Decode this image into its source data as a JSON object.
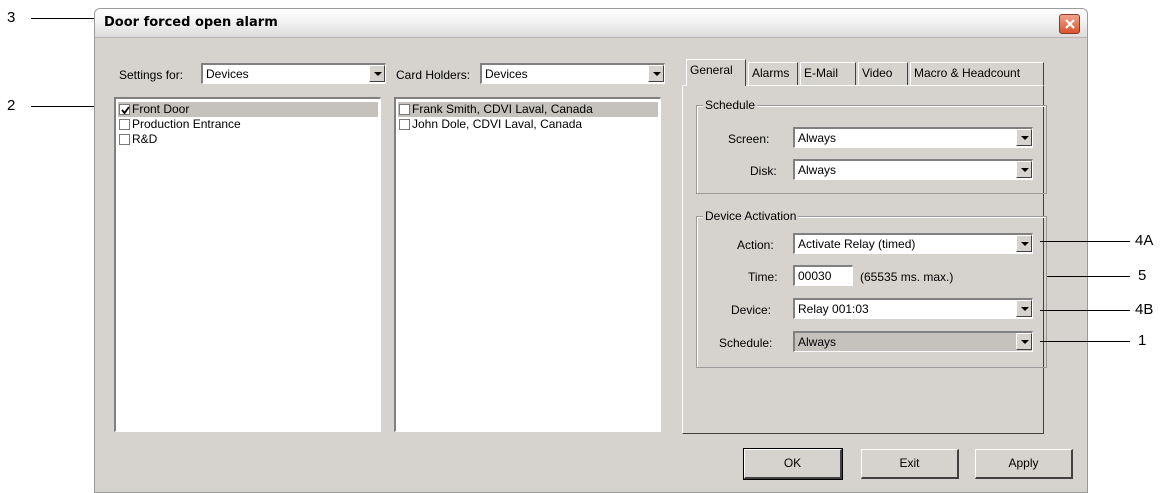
{
  "callouts": {
    "c3": "3",
    "c2": "2",
    "c4a": "4A",
    "c5": "5",
    "c4b": "4B",
    "c1": "1"
  },
  "window": {
    "title": "Door forced open alarm"
  },
  "settings_for": {
    "label": "Settings for:",
    "value": "Devices"
  },
  "card_holders": {
    "label": "Card Holders:",
    "value": "Devices"
  },
  "devices_list": [
    {
      "label": "Front Door",
      "checked": true,
      "selected": true
    },
    {
      "label": "Production Entrance",
      "checked": false,
      "selected": false
    },
    {
      "label": "R&D",
      "checked": false,
      "selected": false
    }
  ],
  "cardholders_list": [
    {
      "label": "Frank Smith, CDVI Laval, Canada",
      "checked": false,
      "selected": true
    },
    {
      "label": "John Dole, CDVI Laval, Canada",
      "checked": false,
      "selected": false
    }
  ],
  "tabs": [
    {
      "label": "General",
      "active": true
    },
    {
      "label": "Alarms",
      "active": false
    },
    {
      "label": "E-Mail",
      "active": false
    },
    {
      "label": "Video",
      "active": false
    },
    {
      "label": "Macro & Headcount",
      "active": false
    }
  ],
  "schedule_group": {
    "title": "Schedule",
    "screen_label": "Screen:",
    "screen_value": "Always",
    "disk_label": "Disk:",
    "disk_value": "Always"
  },
  "activation_group": {
    "title": "Device Activation",
    "action_label": "Action:",
    "action_value": "Activate Relay (timed)",
    "time_label": "Time:",
    "time_value": "00030",
    "time_hint": "(65535 ms. max.)",
    "device_label": "Device:",
    "device_value": "Relay 001:03",
    "schedule_label": "Schedule:",
    "schedule_value": "Always"
  },
  "buttons": {
    "ok": "OK",
    "exit": "Exit",
    "apply": "Apply"
  },
  "colors": {
    "window_bg": "#d6d3ce",
    "selection": "#c5c2bd",
    "close_button": "#d9532e"
  }
}
